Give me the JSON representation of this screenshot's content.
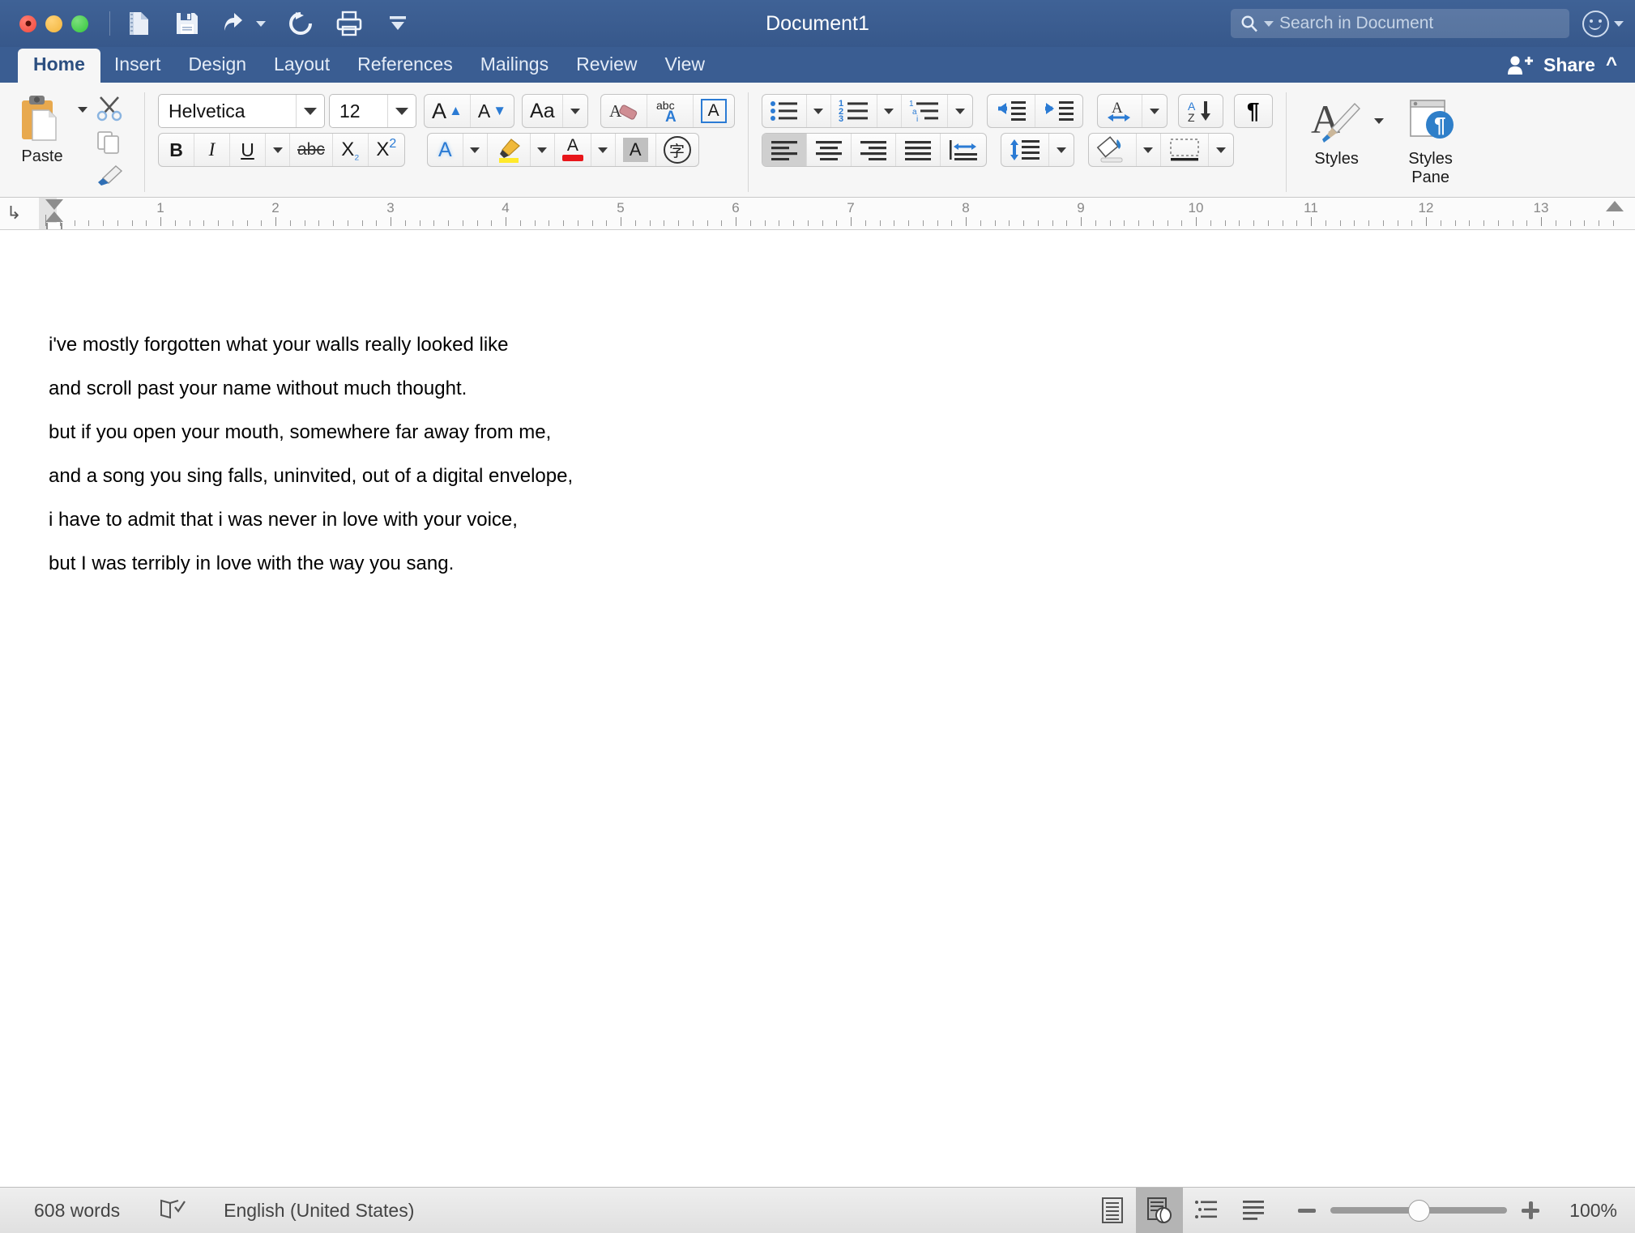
{
  "window": {
    "title": "Document1",
    "traffic_lights": [
      "close",
      "minimize",
      "maximize"
    ]
  },
  "quick_access": {
    "items": [
      {
        "name": "new-document-icon",
        "label": "New Document"
      },
      {
        "name": "save-icon",
        "label": "Save"
      },
      {
        "name": "undo-icon",
        "label": "Undo"
      },
      {
        "name": "redo-icon",
        "label": "Redo"
      },
      {
        "name": "print-icon",
        "label": "Print"
      },
      {
        "name": "customize-toolbar-icon",
        "label": "Customize Toolbar"
      }
    ]
  },
  "search": {
    "placeholder": "Search in Document",
    "icon": "magnifier-icon"
  },
  "tabs": [
    {
      "label": "Home",
      "active": true
    },
    {
      "label": "Insert",
      "active": false
    },
    {
      "label": "Design",
      "active": false
    },
    {
      "label": "Layout",
      "active": false
    },
    {
      "label": "References",
      "active": false
    },
    {
      "label": "Mailings",
      "active": false
    },
    {
      "label": "Review",
      "active": false
    },
    {
      "label": "View",
      "active": false
    }
  ],
  "share": {
    "label": "Share",
    "collapse_icon": "chevron-up-icon"
  },
  "ribbon": {
    "clipboard": {
      "paste_label": "Paste",
      "cut_label": "Cut",
      "copy_label": "Copy",
      "format_painter_label": "Format Painter"
    },
    "font": {
      "font_name": "Helvetica",
      "font_size": "12",
      "grow_font": "A",
      "shrink_font": "A",
      "change_case": "Aa",
      "clear_formatting": "A",
      "spelling": "abc",
      "text_box": "A",
      "bold": "B",
      "italic": "I",
      "underline": "U",
      "strikethrough": "abc",
      "subscript": "X₂",
      "superscript": "X²",
      "text_effects": "A",
      "highlight": "Highlight",
      "font_color": "A",
      "character_shading": "A",
      "asian_layout": "字"
    },
    "paragraph": {
      "bullets": "Bullets",
      "numbering": "Numbering",
      "multilevel": "Multilevel List",
      "decrease_indent": "Decrease Indent",
      "increase_indent": "Increase Indent",
      "ltr_rtl": "A",
      "sort": "Sort",
      "show_marks": "¶",
      "align_left": "Align Left",
      "align_center": "Center",
      "align_right": "Align Right",
      "justify": "Justify",
      "distribute": "Distributed",
      "line_spacing": "Line Spacing",
      "shading": "Shading",
      "borders": "Borders"
    },
    "styles": {
      "styles_label": "Styles",
      "styles_pane_label": "Styles\nPane",
      "styles_pane_line1": "Styles",
      "styles_pane_line2": "Pane"
    }
  },
  "ruler": {
    "numbers": [
      "1",
      "2",
      "3",
      "4",
      "5",
      "6",
      "7",
      "8",
      "9",
      "10",
      "11",
      "12",
      "13"
    ],
    "tab_stop_icon": "tab-stop-icon"
  },
  "document": {
    "lines": [
      "i've mostly forgotten what your walls really looked like",
      "and scroll past your name without much thought.",
      "but if you open your mouth, somewhere far away from me,",
      "and a song you sing falls, uninvited, out of a digital envelope,",
      "i have to admit that i was never in love with your voice,",
      "but I was terribly in love with the way you sang."
    ]
  },
  "status": {
    "word_count": "608 words",
    "proofing_icon": "spell-check-icon",
    "language": "English (United States)",
    "views": [
      {
        "name": "print-layout-view",
        "active": false
      },
      {
        "name": "web-layout-view",
        "active": true
      },
      {
        "name": "outline-view",
        "active": false
      },
      {
        "name": "draft-view",
        "active": false
      }
    ],
    "zoom_out": "-",
    "zoom_in": "+",
    "zoom_level": "100%"
  },
  "colors": {
    "titlebar": "#3a5d92",
    "ribbon_bg": "#f6f6f6",
    "accent_blue": "#2b7bd4",
    "highlight_yellow": "#ffe92b",
    "font_color_red": "#e8161a",
    "active_tab_text": "#2c4f80"
  }
}
